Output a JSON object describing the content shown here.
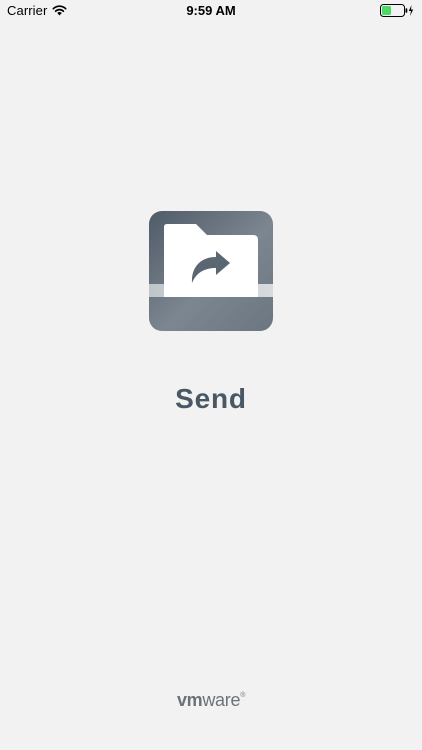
{
  "status_bar": {
    "carrier": "Carrier",
    "time": "9:59 AM",
    "battery_color": "#4cd964",
    "icons": [
      "wifi-icon",
      "battery-icon",
      "charging-bolt-icon"
    ]
  },
  "app": {
    "name": "Send",
    "name_color": "#4a5866",
    "icon": "send-folder-icon"
  },
  "footer": {
    "brand_vm": "vm",
    "brand_ware": "ware",
    "brand_mark": "®",
    "brand_color": "#6b7278"
  }
}
